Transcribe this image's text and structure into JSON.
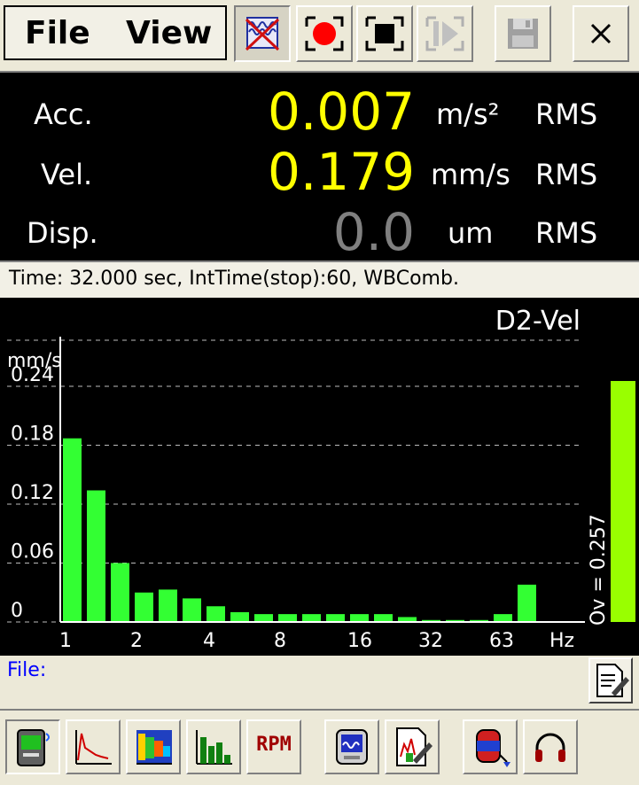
{
  "menu": {
    "file": "File",
    "view": "View"
  },
  "toolbar_icons": [
    "spectrum-toggle-icon",
    "record-icon",
    "stop-icon",
    "step-play-icon",
    "save-icon",
    "close-icon"
  ],
  "measurements": [
    {
      "label": "Acc.",
      "value": "0.007",
      "unit": "m/s²",
      "type": "RMS",
      "color": "#ffff00"
    },
    {
      "label": "Vel.",
      "value": "0.179",
      "unit": "mm/s",
      "type": "RMS",
      "color": "#ffff00"
    },
    {
      "label": "Disp.",
      "value": "0.0",
      "unit": "um",
      "type": "RMS",
      "color": "#808080"
    }
  ],
  "status": "Time: 32.000 sec, IntTime(stop):60, WBComb.",
  "file": {
    "label": "File:"
  },
  "bottom_icons": [
    "meter-icon",
    "time-signal-icon",
    "spectrogram-icon",
    "bar-spectrum-icon",
    "rpm-icon",
    "calibrator-icon",
    "report-edit-icon",
    "sensor-icon",
    "headphones-icon"
  ],
  "bottom_rpm_label": "RPM",
  "chart_data": {
    "type": "bar",
    "title": "D2-Vel",
    "ylabel": "mm/s",
    "xlabel": "Hz",
    "ylim": [
      0,
      0.24
    ],
    "yticks": [
      "0.24",
      "0.18",
      "0.12",
      "0.06",
      "0"
    ],
    "xticks": [
      "1",
      "2",
      "4",
      "8",
      "16",
      "32",
      "63",
      "Hz"
    ],
    "bar_color": "#33ff33",
    "values": [
      0.187,
      0.134,
      0.06,
      0.03,
      0.033,
      0.024,
      0.016,
      0.01,
      0.008,
      0.008,
      0.008,
      0.008,
      0.008,
      0.008,
      0.005,
      0.002,
      0.002,
      0.002,
      0.008,
      0.038
    ],
    "overall": {
      "label": "Ov = 0.257",
      "value": 0.257,
      "color": "#99ff00"
    }
  }
}
